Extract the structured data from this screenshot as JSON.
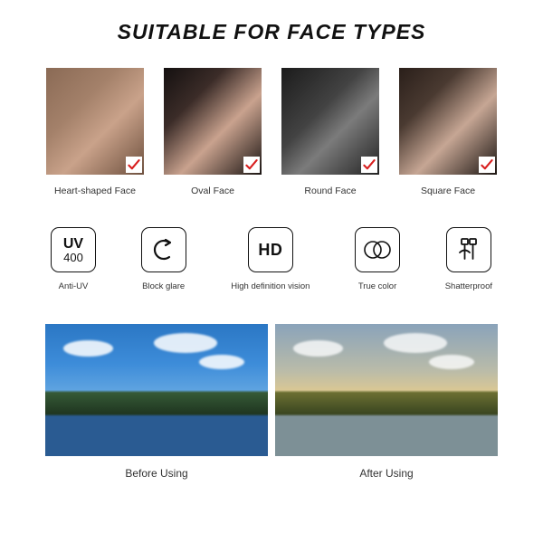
{
  "title": "SUITABLE FOR FACE TYPES",
  "faces": [
    {
      "label": "Heart-shaped Face"
    },
    {
      "label": "Oval Face"
    },
    {
      "label": "Round Face"
    },
    {
      "label": "Square Face"
    }
  ],
  "features": [
    {
      "icon": "uv400",
      "uv_top": "UV",
      "uv_bottom": "400",
      "label": "Anti-UV"
    },
    {
      "icon": "block-glare",
      "label": "Block glare"
    },
    {
      "icon": "hd",
      "hd_text": "HD",
      "label": "High definition vision"
    },
    {
      "icon": "true-color",
      "label": "True color"
    },
    {
      "icon": "shatterproof",
      "label": "Shatterproof"
    }
  ],
  "compare": {
    "before_label": "Before Using",
    "after_label": "After Using"
  }
}
